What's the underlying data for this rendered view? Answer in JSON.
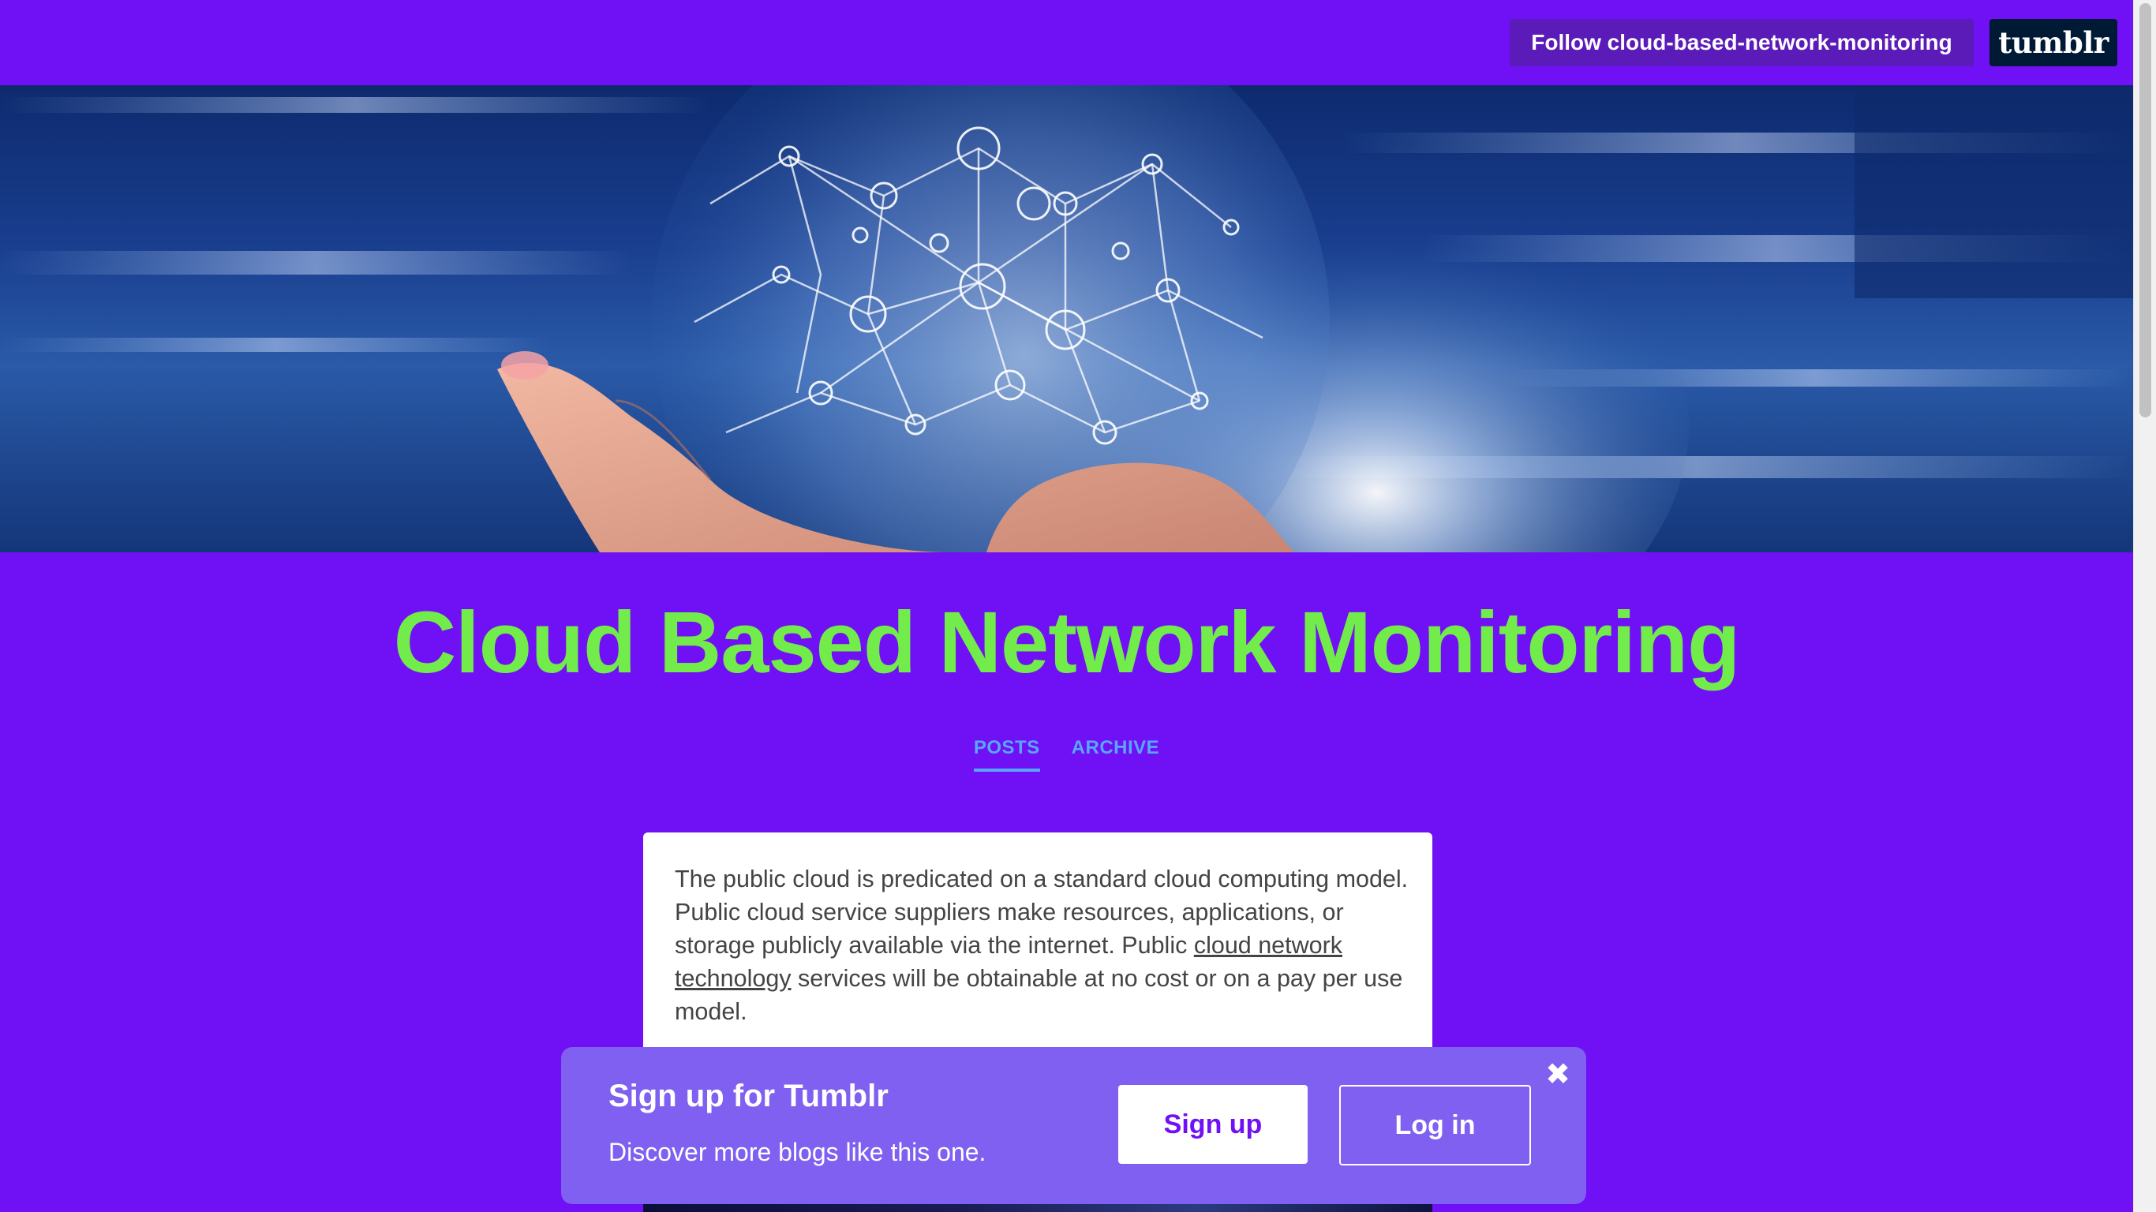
{
  "topbar": {
    "follow_label": "Follow cloud-based-network-monitoring",
    "logo_text": "tumblr"
  },
  "hero": {
    "icon": "network-globe-in-hand-image"
  },
  "blog": {
    "title": "Cloud Based Network Monitoring"
  },
  "nav": {
    "posts_label": "POSTS",
    "archive_label": "ARCHIVE"
  },
  "post": {
    "text_before_link": "The public cloud is predicated on a standard cloud computing model. Public cloud service suppliers make resources, applications, or storage publicly available via the internet. Public ",
    "link_text": "cloud network technology",
    "text_after_link": " services will be obtainable at no cost or on a pay per use model."
  },
  "signup": {
    "title": "Sign up for Tumblr",
    "subtitle": "Discover more blogs like this one.",
    "signup_label": "Sign up",
    "login_label": "Log in",
    "close_glyph": "✖"
  },
  "colors": {
    "background": "#7010f5",
    "title": "#72ec4a",
    "nav_link": "#57a8ff",
    "follow_button": "#5b1bb8",
    "logo_bg": "#001935",
    "signup_banner": "#7f60f0"
  }
}
